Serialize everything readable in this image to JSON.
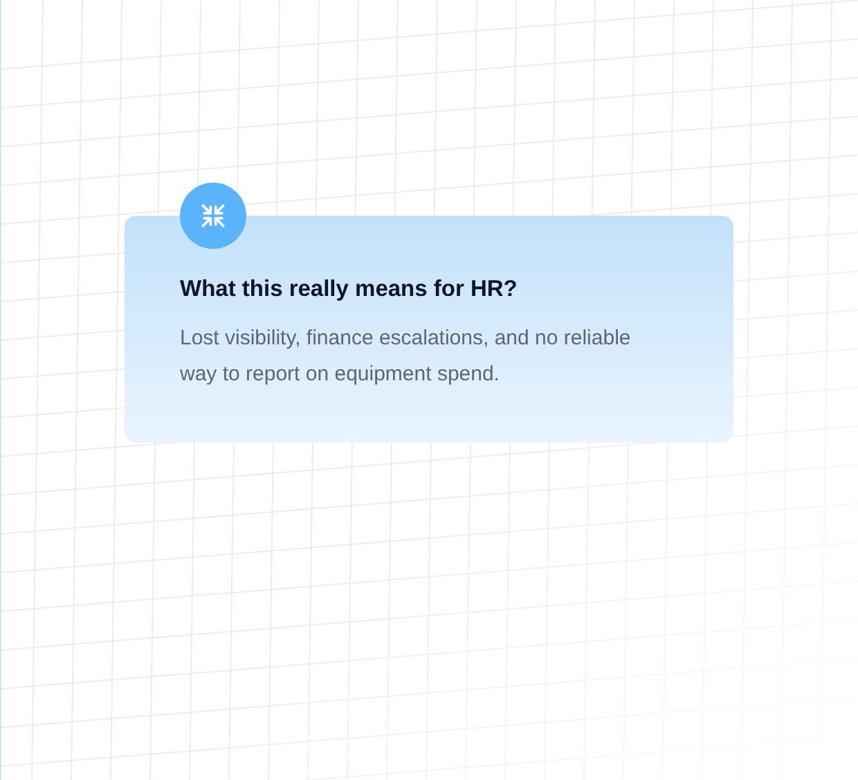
{
  "card": {
    "title": "What this really means for HR?",
    "body": "Lost visibility, finance escalations, and no reliable way to report on equipment spend."
  }
}
